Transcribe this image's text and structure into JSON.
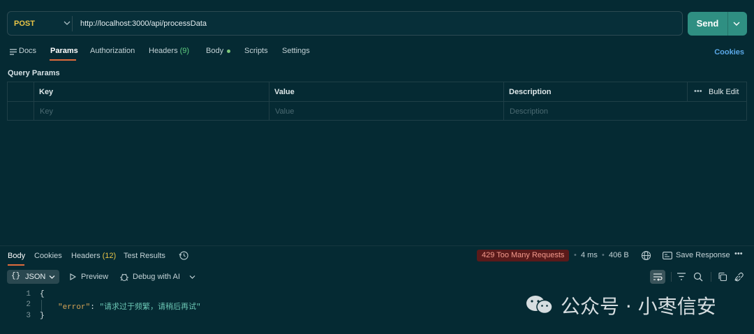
{
  "request": {
    "method": "POST",
    "url": "http://localhost:3000/api/processData",
    "send_label": "Send"
  },
  "request_tabs": {
    "docs": "Docs",
    "params": "Params",
    "authorization": "Authorization",
    "headers": "Headers",
    "headers_count": "(9)",
    "body": "Body",
    "scripts": "Scripts",
    "settings": "Settings",
    "cookies": "Cookies"
  },
  "query_params": {
    "title": "Query Params",
    "columns": [
      "Key",
      "Value",
      "Description"
    ],
    "placeholders": [
      "Key",
      "Value",
      "Description"
    ],
    "bulk_edit": "Bulk Edit"
  },
  "response_tabs": {
    "body": "Body",
    "cookies": "Cookies",
    "headers": "Headers",
    "headers_count": "(12)",
    "test_results": "Test Results"
  },
  "response_meta": {
    "status": "429 Too Many Requests",
    "time": "4 ms",
    "size": "406 B",
    "save": "Save Response",
    "status_color": "#5a1a1a"
  },
  "response_toolbar": {
    "format": "JSON",
    "preview": "Preview",
    "debug": "Debug with AI"
  },
  "response_body": {
    "line_numbers": [
      "1",
      "2",
      "3"
    ],
    "open_brace": "{",
    "key": "\"error\"",
    "colon": ":",
    "value": "\"请求过于频繁，请稍后再试\"",
    "close_brace": "}"
  },
  "watermark": "公众号 · 小枣信安",
  "colors": {
    "background": "#052a33",
    "accent": "#2f8f82",
    "method": "#e8c547",
    "active_tab_underline": "#e06c3c",
    "link": "#5aa7e6"
  }
}
